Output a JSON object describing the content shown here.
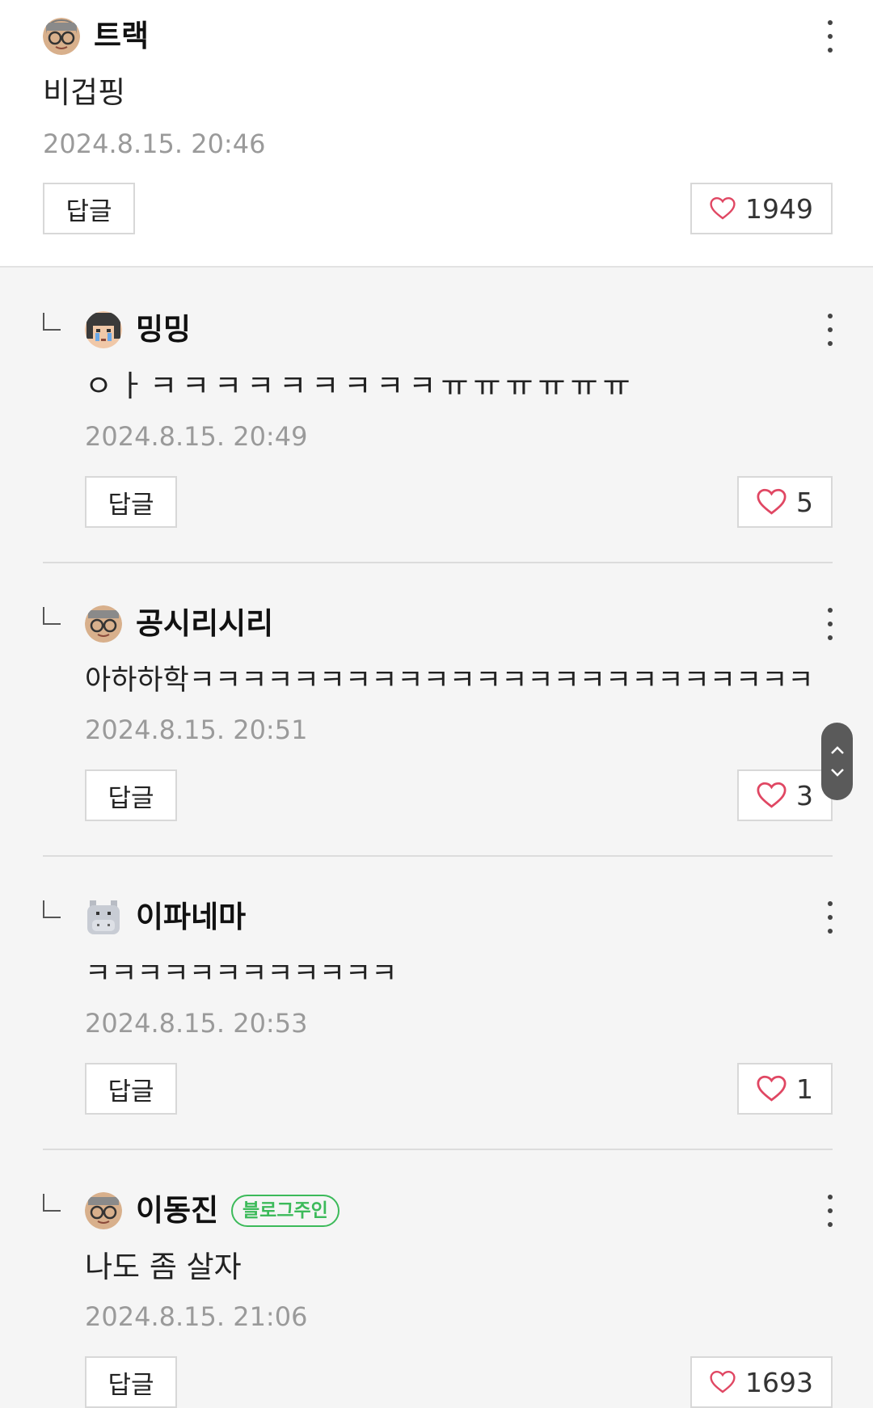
{
  "comments": [
    {
      "nickname": "트랙",
      "text": "비겁핑",
      "date": "2024.8.15. 20:46",
      "reply_label": "답글",
      "likes": "1949",
      "is_reply": false,
      "avatar": "glasses-avatar"
    },
    {
      "nickname": "밍밍",
      "text": "ㅇㅏㅋㅋㅋㅋㅋㅋㅋㅋㅋㅠㅠㅠㅠㅠㅠ",
      "date": "2024.8.15. 20:49",
      "reply_label": "답글",
      "likes": "5",
      "is_reply": true,
      "avatar": "crying-avatar"
    },
    {
      "nickname": "공시리시리",
      "text": "아하하학ㅋㅋㅋㅋㅋㅋㅋㅋㅋㅋㅋㅋㅋㅋㅋㅋㅋㅋㅋㅋㅋㅋㅋㅋ",
      "date": "2024.8.15. 20:51",
      "reply_label": "답글",
      "likes": "3",
      "is_reply": true,
      "avatar": "glasses-avatar"
    },
    {
      "nickname": "이파네마",
      "text": "ㅋㅋㅋㅋㅋㅋㅋㅋㅋㅋㅋㅋ",
      "date": "2024.8.15. 20:53",
      "reply_label": "답글",
      "likes": "1",
      "is_reply": true,
      "avatar": "hippo-avatar"
    },
    {
      "nickname": "이동진",
      "badge": "블로그주인",
      "text": "나도 좀 살자",
      "date": "2024.8.15. 21:06",
      "reply_label": "답글",
      "likes": "1693",
      "is_reply": true,
      "avatar": "glasses-avatar"
    }
  ],
  "icons": {
    "like": "heart-outline-icon",
    "more": "more-vertical-icon",
    "scroll_up": "chevron-up-icon",
    "scroll_down": "chevron-down-icon"
  },
  "colors": {
    "heart": "#e04763",
    "owner_badge": "#3cba5a",
    "date": "#9a9a9a"
  }
}
